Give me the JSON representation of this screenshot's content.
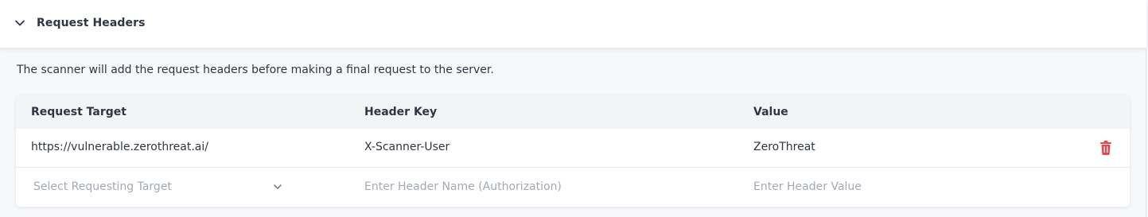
{
  "section": {
    "title": "Request Headers",
    "expanded": true,
    "description": "The scanner will add the request headers before making a final request to the server."
  },
  "table": {
    "columns": [
      "Request Target",
      "Header Key",
      "Value"
    ],
    "rows": [
      {
        "request_target": "https://vulnerable.zerothreat.ai/",
        "header_key": "X-Scanner-User",
        "value": "ZeroThreat",
        "delete_icon": "trash-icon"
      }
    ],
    "new_row": {
      "target_placeholder": "Select Requesting Target",
      "key_placeholder": "Enter Header Name (Authorization)",
      "value_placeholder": "Enter Header Value"
    }
  },
  "colors": {
    "delete": "#e5484d",
    "placeholder": "#a3a9b3",
    "text": "#2f3542"
  }
}
